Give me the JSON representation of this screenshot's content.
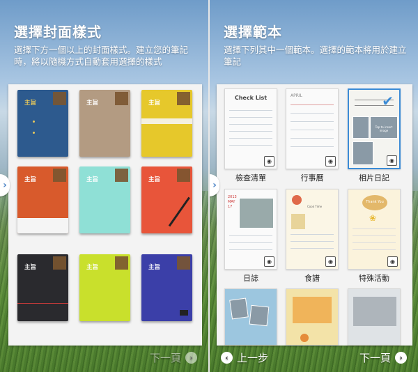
{
  "left": {
    "title": "選擇封面樣式",
    "subtitle": "選擇下方一個以上的封面樣式。建立您的筆記時，將以隨機方式自動套用選擇的樣式",
    "cover_label": "主旨",
    "covers": [
      {
        "color": "#2d5a8e"
      },
      {
        "color": "#b39b82"
      },
      {
        "color": "#e6c82b"
      },
      {
        "color": "#d85a2c"
      },
      {
        "color": "#8fe0d6"
      },
      {
        "color": "#e8553a"
      },
      {
        "color": "#2a2a2e"
      },
      {
        "color": "#c9e02c"
      },
      {
        "color": "#3b3fa8"
      }
    ],
    "next_label": "下一頁"
  },
  "right": {
    "title": "選擇範本",
    "subtitle": "選擇下列其中一個範本。選擇的範本將用於建立筆記",
    "templates": [
      {
        "name": "檢查清單",
        "card_text": "Check List"
      },
      {
        "name": "行事曆",
        "card_text": "APRIL"
      },
      {
        "name": "相片日記",
        "card_text": "Tap to insert image"
      },
      {
        "name": "日誌",
        "card_text": "2013 MAY 17"
      },
      {
        "name": "食譜",
        "card_text": "Cook Time"
      },
      {
        "name": "特殊活動",
        "card_text": "Thank You"
      },
      {
        "name": "",
        "card_text": ""
      },
      {
        "name": "",
        "card_text": ""
      },
      {
        "name": "",
        "card_text": ""
      }
    ],
    "prev_label": "上一步",
    "next_label": "下一頁"
  },
  "colors": {
    "accent": "#3b8bd6"
  }
}
